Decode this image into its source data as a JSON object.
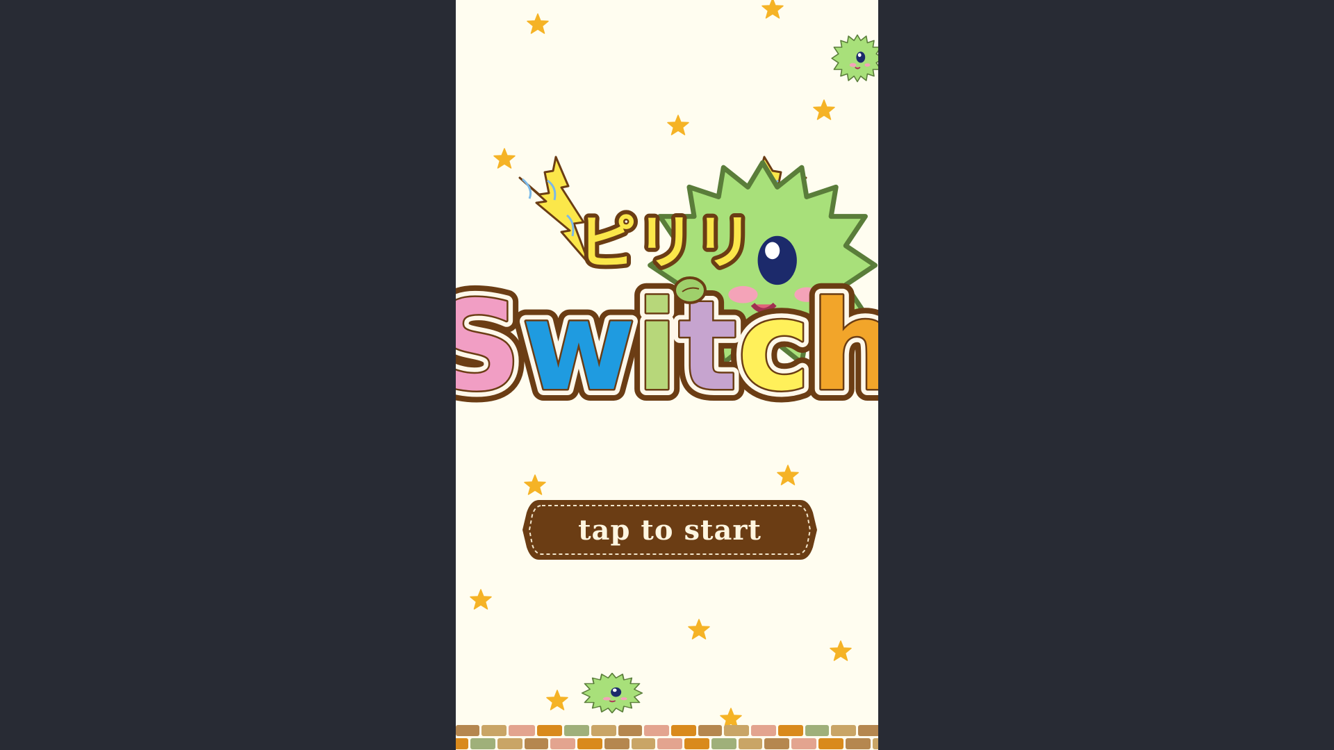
{
  "title": {
    "katakana": "ピリリ",
    "word": "Switch",
    "letter_colors": [
      "#f19ec4",
      "#1f9be0",
      "#b7d77a",
      "#c6a4cf",
      "#fff05a",
      "#f2a52a"
    ],
    "outline_color": "#6b3d14"
  },
  "start_button": {
    "label": "tap to start",
    "fill_color": "#6b3d14",
    "text_color": "#fff6e0"
  },
  "colors": {
    "background": "#282b34",
    "stage": "#fffdf0",
    "star": "#f5b326",
    "creature": "#a8e07a",
    "lightning": "#fbe74a"
  },
  "icons": [
    "star-icon",
    "fuzzball-creature-icon",
    "lightning-bolt-icon",
    "leaf-icon"
  ]
}
